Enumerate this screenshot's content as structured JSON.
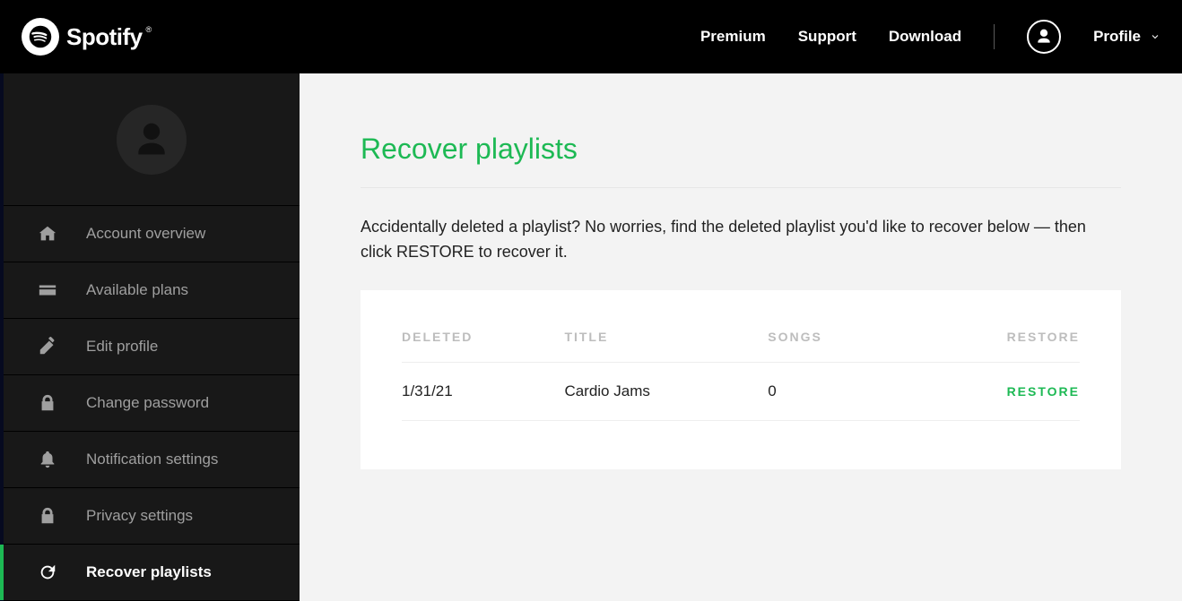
{
  "header": {
    "brand": "Spotify",
    "nav": {
      "premium": "Premium",
      "support": "Support",
      "download": "Download",
      "profile": "Profile"
    }
  },
  "sidebar": {
    "items": [
      {
        "icon": "home",
        "label": "Account overview"
      },
      {
        "icon": "card",
        "label": "Available plans"
      },
      {
        "icon": "pencil",
        "label": "Edit profile"
      },
      {
        "icon": "lock",
        "label": "Change password"
      },
      {
        "icon": "bell",
        "label": "Notification settings"
      },
      {
        "icon": "lock",
        "label": "Privacy settings"
      },
      {
        "icon": "refresh",
        "label": "Recover playlists",
        "active": true
      }
    ]
  },
  "main": {
    "title": "Recover playlists",
    "description": "Accidentally deleted a playlist? No worries, find the deleted playlist you'd like to recover below — then click RESTORE to recover it.",
    "table": {
      "columns": {
        "deleted": "DELETED",
        "title": "TITLE",
        "songs": "SONGS",
        "restore": "RESTORE"
      },
      "rows": [
        {
          "deleted": "1/31/21",
          "title": "Cardio Jams",
          "songs": "0",
          "restore": "RESTORE"
        }
      ]
    }
  }
}
